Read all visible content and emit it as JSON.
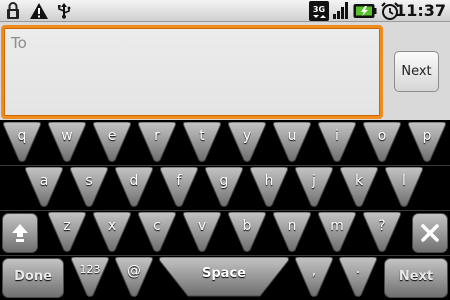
{
  "status_bar": {
    "icons": [
      "lock-icon",
      "warning-icon",
      "usb-icon",
      "3g-icon",
      "signal-icon",
      "battery-charging-icon",
      "alarm-clock-icon"
    ],
    "network_label": "3G",
    "time": "11:37"
  },
  "compose": {
    "to_placeholder": "To",
    "next_label": "Next"
  },
  "keyboard": {
    "row1": [
      "q",
      "w",
      "e",
      "r",
      "t",
      "y",
      "u",
      "i",
      "o",
      "p"
    ],
    "row2": [
      "a",
      "s",
      "d",
      "f",
      "g",
      "h",
      "j",
      "k",
      "l"
    ],
    "row3": [
      "z",
      "x",
      "c",
      "v",
      "b",
      "n",
      "m",
      "?"
    ],
    "done_label": "Done",
    "symbols_label": "123",
    "at_label": "@",
    "space_label": "Space",
    "comma_label": ",",
    "period_label": ".",
    "next_label": "Next",
    "shift_icon": "shift-arrow-icon",
    "delete_icon": "delete-x-icon"
  },
  "colors": {
    "accent_focus": "#f08c1e",
    "key_face": "#9a9a9a",
    "keyboard_bg": "#000000"
  }
}
